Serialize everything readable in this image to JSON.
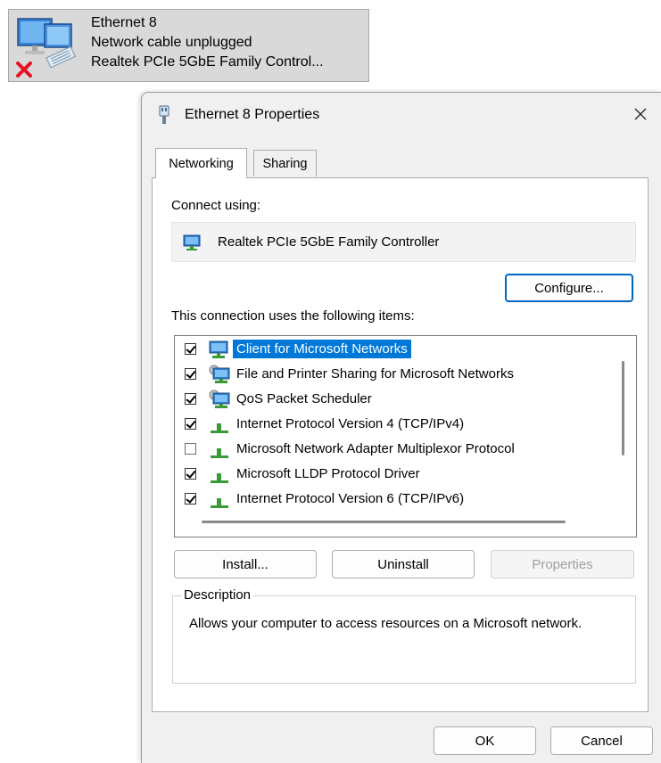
{
  "adapter_tile": {
    "name": "Ethernet 8",
    "status": "Network cable unplugged",
    "device": "Realtek PCIe 5GbE Family Control..."
  },
  "dialog": {
    "title": "Ethernet 8 Properties",
    "close_glyph": "✕",
    "tabs": [
      {
        "label": "Networking",
        "active": true
      },
      {
        "label": "Sharing",
        "active": false
      }
    ],
    "connect_using_label": "Connect using:",
    "adapter_name": "Realtek PCIe 5GbE Family Controller",
    "configure_label": "Configure...",
    "items_label": "This connection uses the following items:",
    "items": [
      {
        "label": "Client for Microsoft Networks",
        "checked": true,
        "selected": true,
        "icon": "network-client-icon"
      },
      {
        "label": "File and Printer Sharing for Microsoft Networks",
        "checked": true,
        "selected": false,
        "icon": "network-service-icon"
      },
      {
        "label": "QoS Packet Scheduler",
        "checked": true,
        "selected": false,
        "icon": "network-service-icon"
      },
      {
        "label": "Internet Protocol Version 4 (TCP/IPv4)",
        "checked": true,
        "selected": false,
        "icon": "network-protocol-icon"
      },
      {
        "label": "Microsoft Network Adapter Multiplexor Protocol",
        "checked": false,
        "selected": false,
        "icon": "network-protocol-icon"
      },
      {
        "label": "Microsoft LLDP Protocol Driver",
        "checked": true,
        "selected": false,
        "icon": "network-protocol-icon"
      },
      {
        "label": "Internet Protocol Version 6 (TCP/IPv6)",
        "checked": true,
        "selected": false,
        "icon": "network-protocol-icon"
      }
    ],
    "install_label": "Install...",
    "uninstall_label": "Uninstall",
    "properties_label": "Properties",
    "description_title": "Description",
    "description_text": "Allows your computer to access resources on a Microsoft network.",
    "ok_label": "OK",
    "cancel_label": "Cancel"
  },
  "colors": {
    "selection": "#0078d7",
    "primary_border": "#0067c0",
    "error_x": "#e81123"
  }
}
